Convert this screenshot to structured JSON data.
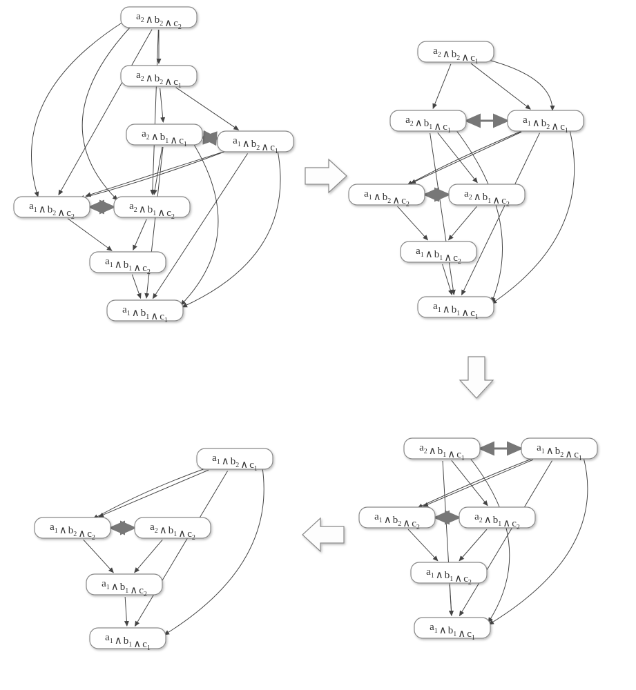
{
  "domain": "Diagram",
  "description": "Sequence of four directed-acyclic graphs (DAGs) over conjunctive-literal nodes, connected by large hollow transition arrows indicating iterative graph reduction.",
  "node_template": "a_{i} ∧ b_{j} ∧ c_{k}",
  "nodes_meaning": "Each node is a conjunction of one literal from each of three variable families a, b, c with subscript in {1,2}.",
  "transition_arrows": [
    "right",
    "down",
    "left"
  ],
  "chart_data": {
    "type": "dag-sequence",
    "panels": [
      {
        "id": "P1_top_left",
        "nodes": [
          "a2b2c2",
          "a2b2c1",
          "a2b1c1",
          "a1b2c1",
          "a1b2c2",
          "a2b1c2",
          "a1b1c2",
          "a1b1c1"
        ],
        "edges": [
          [
            "a2b2c2",
            "a2b2c1"
          ],
          [
            "a2b2c2",
            "a1b2c2"
          ],
          [
            "a2b2c2",
            "a2b1c2"
          ],
          [
            "a2b2c1",
            "a2b1c1"
          ],
          [
            "a2b2c1",
            "a1b2c1"
          ],
          [
            "a2b1c1",
            "a1b2c1",
            "bidir-thick"
          ],
          [
            "a2b1c1",
            "a2b1c2"
          ],
          [
            "a2b1c1",
            "a1b1c1"
          ],
          [
            "a1b2c1",
            "a1b2c2"
          ],
          [
            "a1b2c1",
            "a1b1c1"
          ],
          [
            "a2b1c2",
            "a1b2c2",
            "bidir-thick"
          ],
          [
            "a2b1c2",
            "a1b1c2"
          ],
          [
            "a1b2c2",
            "a1b1c2"
          ],
          [
            "a1b1c2",
            "a1b1c1"
          ]
        ]
      },
      {
        "id": "P2_top_right",
        "nodes": [
          "a2b2c1",
          "a2b1c1",
          "a1b2c1",
          "a1b2c2",
          "a2b1c2",
          "a1b1c2",
          "a1b1c1"
        ],
        "edges": [
          [
            "a2b2c1",
            "a2b1c1"
          ],
          [
            "a2b2c1",
            "a1b2c1"
          ],
          [
            "a2b1c1",
            "a1b2c1",
            "bidir-thick"
          ],
          [
            "a2b1c1",
            "a2b1c2"
          ],
          [
            "a2b1c1",
            "a1b1c1"
          ],
          [
            "a1b2c1",
            "a1b2c2"
          ],
          [
            "a1b2c1",
            "a1b1c1"
          ],
          [
            "a2b1c2",
            "a1b2c2",
            "bidir-thick"
          ],
          [
            "a2b1c2",
            "a1b1c2"
          ],
          [
            "a1b2c2",
            "a1b1c2"
          ],
          [
            "a1b1c2",
            "a1b1c1"
          ]
        ]
      },
      {
        "id": "P3_bottom_right",
        "nodes": [
          "a2b1c1",
          "a1b2c1",
          "a1b2c2",
          "a2b1c2",
          "a1b1c2",
          "a1b1c1"
        ],
        "edges": [
          [
            "a2b1c1",
            "a1b2c1",
            "bidir-thick"
          ],
          [
            "a2b1c1",
            "a2b1c2"
          ],
          [
            "a2b1c1",
            "a1b1c1"
          ],
          [
            "a1b2c1",
            "a1b2c2"
          ],
          [
            "a1b2c1",
            "a1b1c1"
          ],
          [
            "a2b1c2",
            "a1b2c2",
            "bidir-thick"
          ],
          [
            "a2b1c2",
            "a1b1c2"
          ],
          [
            "a1b2c2",
            "a1b1c2"
          ],
          [
            "a1b1c2",
            "a1b1c1"
          ]
        ]
      },
      {
        "id": "P4_bottom_left",
        "nodes": [
          "a1b2c1",
          "a1b2c2",
          "a2b1c2",
          "a1b1c2",
          "a1b1c1"
        ],
        "edges": [
          [
            "a1b2c1",
            "a1b2c2"
          ],
          [
            "a1b2c1",
            "a1b1c1"
          ],
          [
            "a2b1c2",
            "a1b2c2",
            "bidir-thick"
          ],
          [
            "a2b1c2",
            "a1b1c2"
          ],
          [
            "a1b2c2",
            "a1b1c2"
          ],
          [
            "a1b1c2",
            "a1b1c1"
          ]
        ]
      }
    ]
  }
}
